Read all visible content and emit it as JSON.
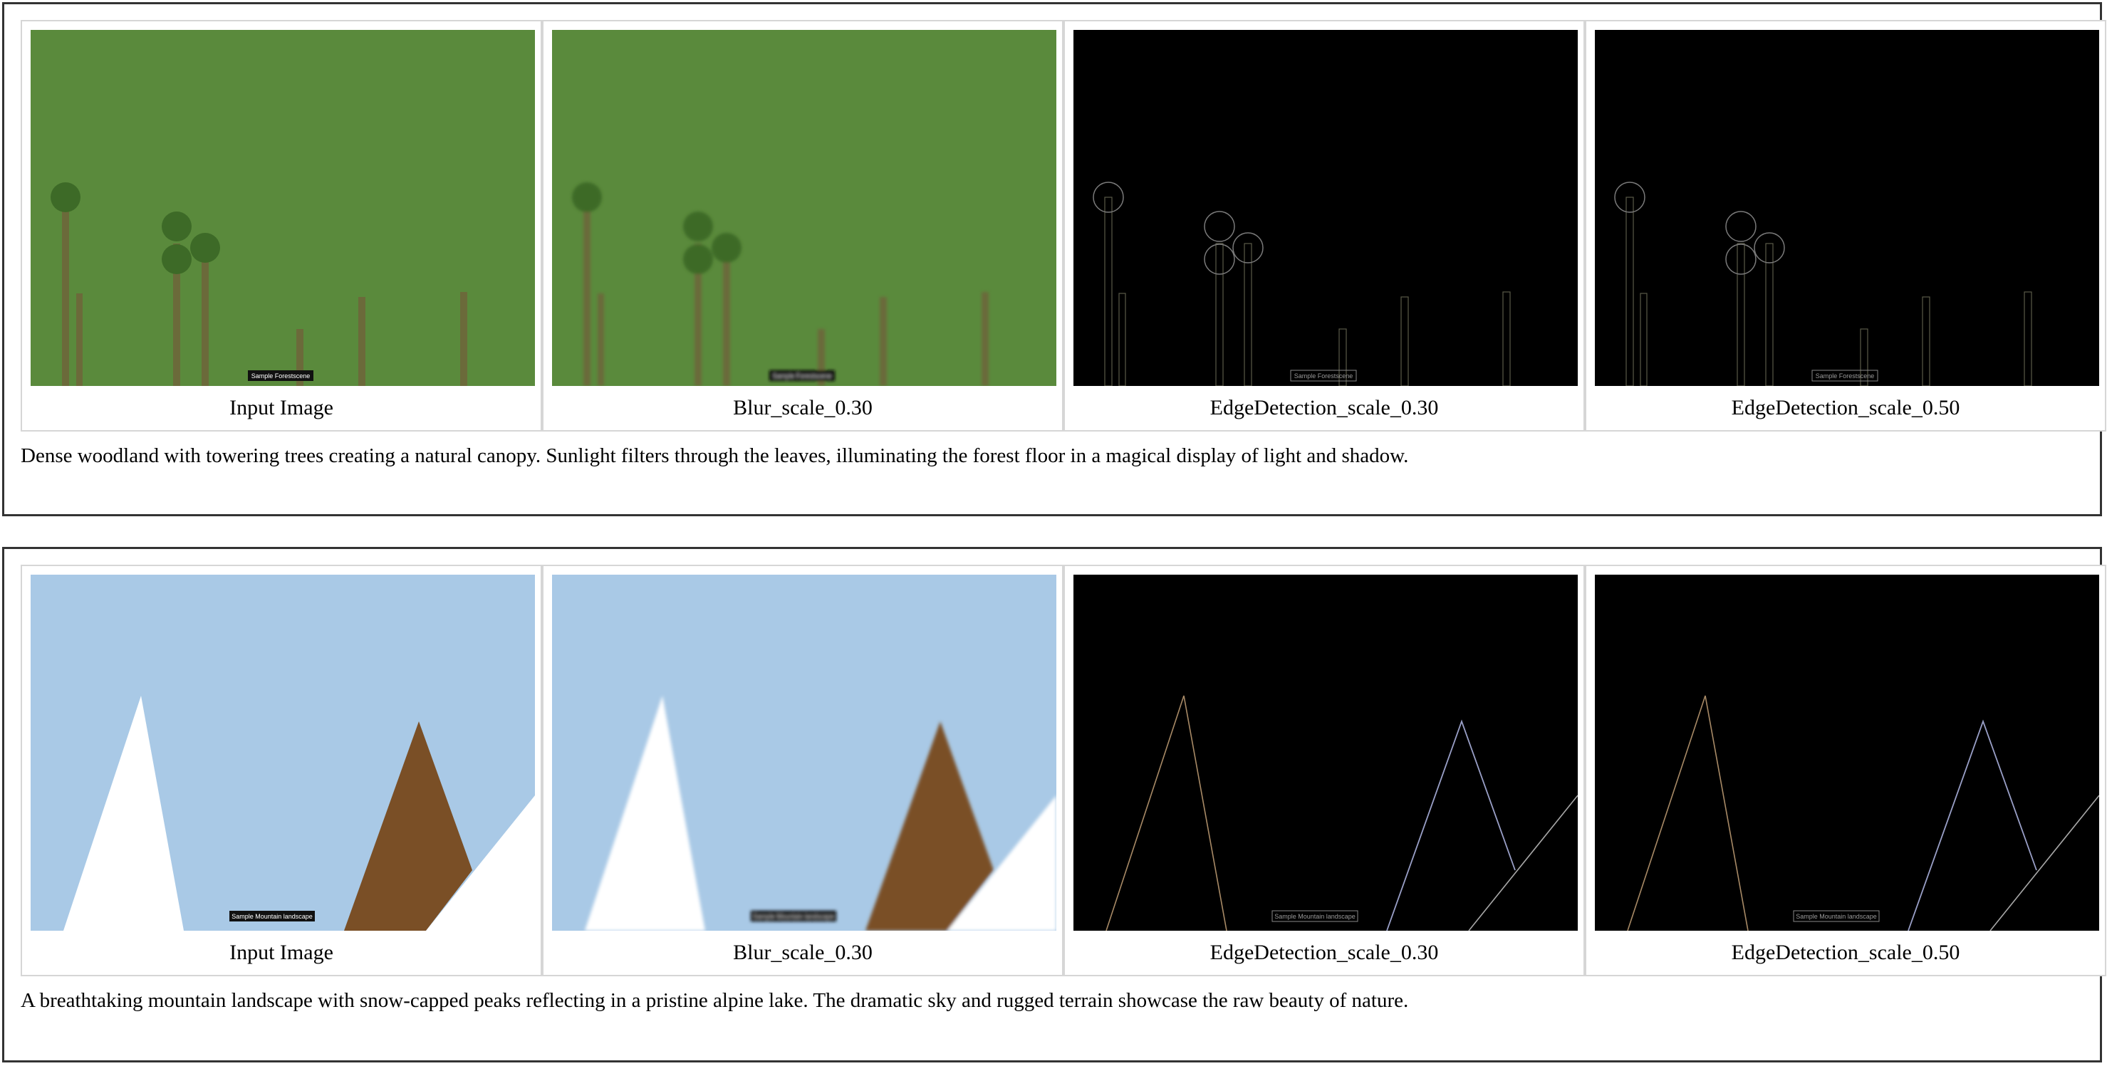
{
  "sections": [
    {
      "scene": "forest",
      "banner": "Sample Forestscene",
      "panels": [
        {
          "caption": "Input Image"
        },
        {
          "caption": "Blur_scale_0.30"
        },
        {
          "caption": "EdgeDetection_scale_0.30"
        },
        {
          "caption": "EdgeDetection_scale_0.50"
        }
      ],
      "description": "Dense woodland with towering trees creating a natural canopy. Sunlight filters through the leaves, illuminating the forest floor in a magical display of light and shadow."
    },
    {
      "scene": "mountain",
      "banner": "Sample Mountain landscape",
      "panels": [
        {
          "caption": "Input Image"
        },
        {
          "caption": "Blur_scale_0.30"
        },
        {
          "caption": "EdgeDetection_scale_0.30"
        },
        {
          "caption": "EdgeDetection_scale_0.50"
        }
      ],
      "description": "A breathtaking mountain landscape with snow-capped peaks reflecting in a pristine alpine lake. The dramatic sky and rugged terrain showcase the raw beauty of nature."
    }
  ],
  "colors": {
    "forest_bg": "#5a8a3c",
    "tree_crown": "#3d6a27",
    "tree_trunk": "#6b6a3a",
    "sky": "#a9c9e6",
    "snow_peak": "#ffffff",
    "brown_peak": "#7a4f26",
    "edge_bg": "#000000"
  }
}
